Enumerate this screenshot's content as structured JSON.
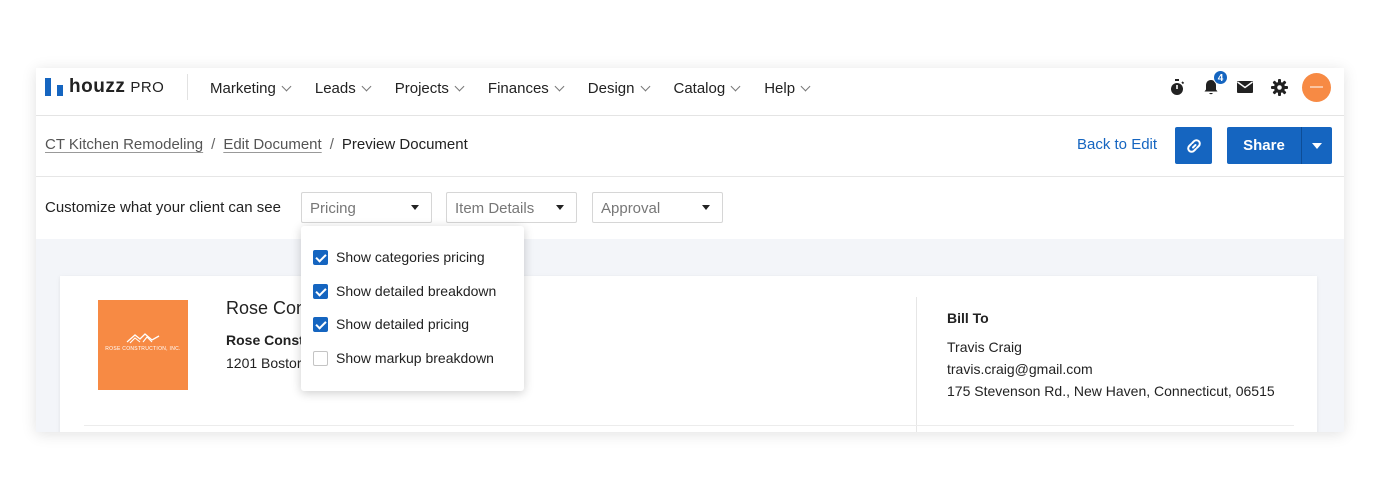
{
  "brand": {
    "name": "houzz",
    "suffix": "PRO",
    "color": "#1565c0"
  },
  "nav": {
    "items": [
      {
        "label": "Marketing"
      },
      {
        "label": "Leads"
      },
      {
        "label": "Projects"
      },
      {
        "label": "Finances"
      },
      {
        "label": "Design"
      },
      {
        "label": "Catalog"
      },
      {
        "label": "Help"
      }
    ],
    "icons": [
      "stopwatch-icon",
      "bell-icon",
      "mail-icon",
      "gear-icon",
      "avatar"
    ],
    "notification_count": "4"
  },
  "breadcrumb": {
    "items": [
      {
        "label": "CT Kitchen Remodeling"
      },
      {
        "label": "Edit Document"
      },
      {
        "label": "Preview Document"
      }
    ],
    "separator": "/"
  },
  "actions": {
    "back_to_edit": "Back to Edit",
    "share": "Share",
    "link_icon": "link-icon"
  },
  "customize": {
    "label": "Customize what your client can see",
    "selects": [
      {
        "value": "Pricing"
      },
      {
        "value": "Item Details"
      },
      {
        "value": "Approval"
      }
    ]
  },
  "pricing_menu": {
    "options": [
      {
        "label": "Show categories pricing",
        "checked": true
      },
      {
        "label": "Show detailed breakdown",
        "checked": true
      },
      {
        "label": "Show detailed pricing",
        "checked": true
      },
      {
        "label": "Show markup breakdown",
        "checked": false
      }
    ]
  },
  "document": {
    "logo_text": "ROSE CONSTRUCTION, INC.",
    "company_title": "Rose Con",
    "company_name": "Rose Const",
    "company_address": "1201 Bostor",
    "bill_to": {
      "title": "Bill To",
      "name": "Travis Craig",
      "email": "travis.craig@gmail.com",
      "address": "175 Stevenson Rd., New Haven, Connecticut, 06515"
    }
  },
  "colors": {
    "accent": "#1565c0",
    "logo_bg": "#f78a44",
    "canvas_bg": "#f3f5f9"
  }
}
